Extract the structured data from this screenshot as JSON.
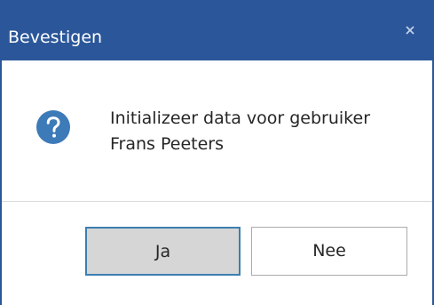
{
  "window": {
    "title": "Bevestigen",
    "close_icon": "close-icon",
    "accent_color": "#2b579a"
  },
  "message": {
    "icon": "question-icon",
    "line1": "Initializeer data voor gebruiker",
    "line2": "Frans Peeters"
  },
  "buttons": {
    "yes_label": "Ja",
    "no_label": "Nee"
  }
}
